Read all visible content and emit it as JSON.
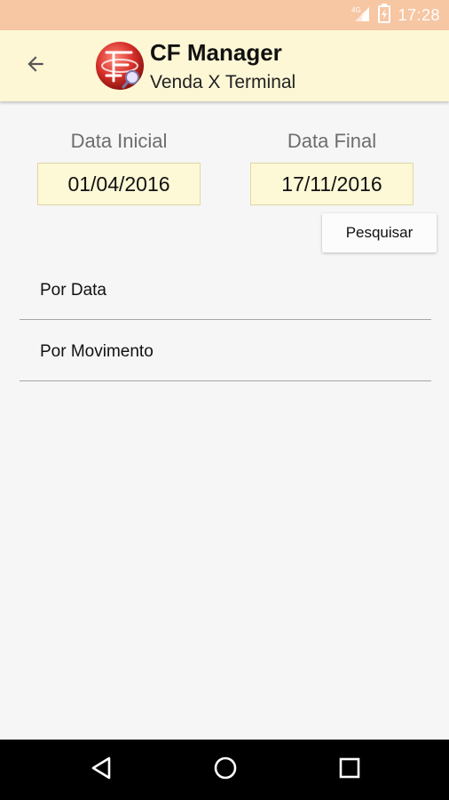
{
  "status_bar": {
    "time": "17:28",
    "signal_icon": "cell-signal-icon",
    "battery_icon": "battery-icon",
    "background": "#f7c6a3"
  },
  "app_bar": {
    "back_icon": "arrow-back-icon",
    "logo_icon": "cf-manager-logo",
    "title": "CF Manager",
    "subtitle": "Venda X Terminal",
    "background": "#fdf7d5"
  },
  "filters": {
    "start_label": "Data Inicial",
    "start_value": "01/04/2016",
    "end_label": "Data Final",
    "end_value": "17/11/2016",
    "search_button": "Pesquisar",
    "field_background": "#fdf8d6"
  },
  "list": {
    "items": [
      {
        "label": "Por Data"
      },
      {
        "label": "Por Movimento"
      }
    ]
  },
  "nav_bar": {
    "back_icon": "nav-back-triangle-icon",
    "home_icon": "nav-home-circle-icon",
    "recents_icon": "nav-recents-square-icon"
  }
}
